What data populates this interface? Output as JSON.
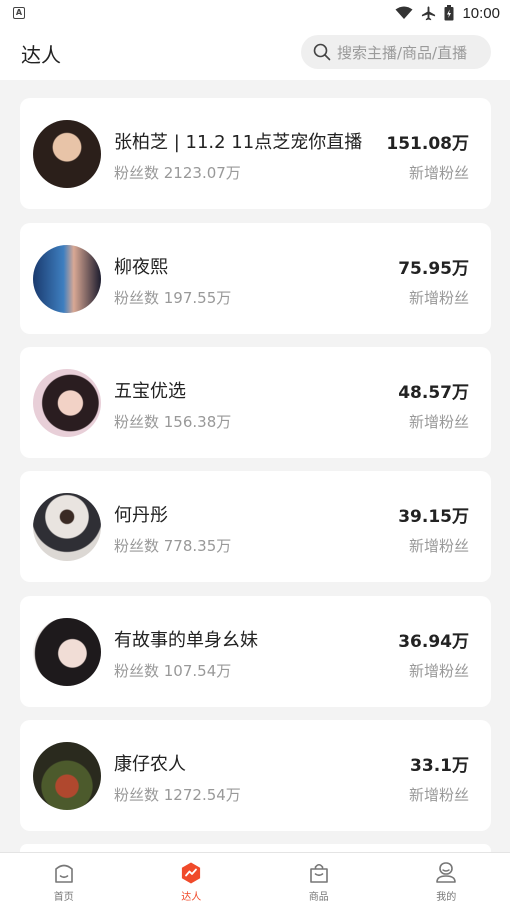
{
  "status_bar": {
    "time": "10:00",
    "left_icon": "A"
  },
  "header": {
    "title": "达人",
    "search_placeholder": "搜索主播/商品/直播"
  },
  "influencers": [
    {
      "name": "张柏芝 | 11.2 11点芝宠你直播",
      "fans_label": "粉丝数 2123.07万",
      "growth": "151.08万",
      "growth_label": "新增粉丝"
    },
    {
      "name": "柳夜熙",
      "fans_label": "粉丝数 197.55万",
      "growth": "75.95万",
      "growth_label": "新增粉丝"
    },
    {
      "name": "五宝优选",
      "fans_label": "粉丝数 156.38万",
      "growth": "48.57万",
      "growth_label": "新增粉丝"
    },
    {
      "name": "何丹彤",
      "fans_label": "粉丝数 778.35万",
      "growth": "39.15万",
      "growth_label": "新增粉丝"
    },
    {
      "name": "有故事的单身幺妹",
      "fans_label": "粉丝数 107.54万",
      "growth": "36.94万",
      "growth_label": "新增粉丝"
    },
    {
      "name": "康仔农人",
      "fans_label": "粉丝数 1272.54万",
      "growth": "33.1万",
      "growth_label": "新增粉丝"
    }
  ],
  "tabbar": {
    "tabs": [
      {
        "label": "首页",
        "icon": "home-icon"
      },
      {
        "label": "达人",
        "icon": "trending-icon"
      },
      {
        "label": "商品",
        "icon": "shopping-bag-icon"
      },
      {
        "label": "我的",
        "icon": "profile-icon"
      }
    ],
    "active_index": 1
  },
  "colors": {
    "accent": "#f04a2a",
    "background": "#f3f3f3",
    "card": "#ffffff"
  }
}
